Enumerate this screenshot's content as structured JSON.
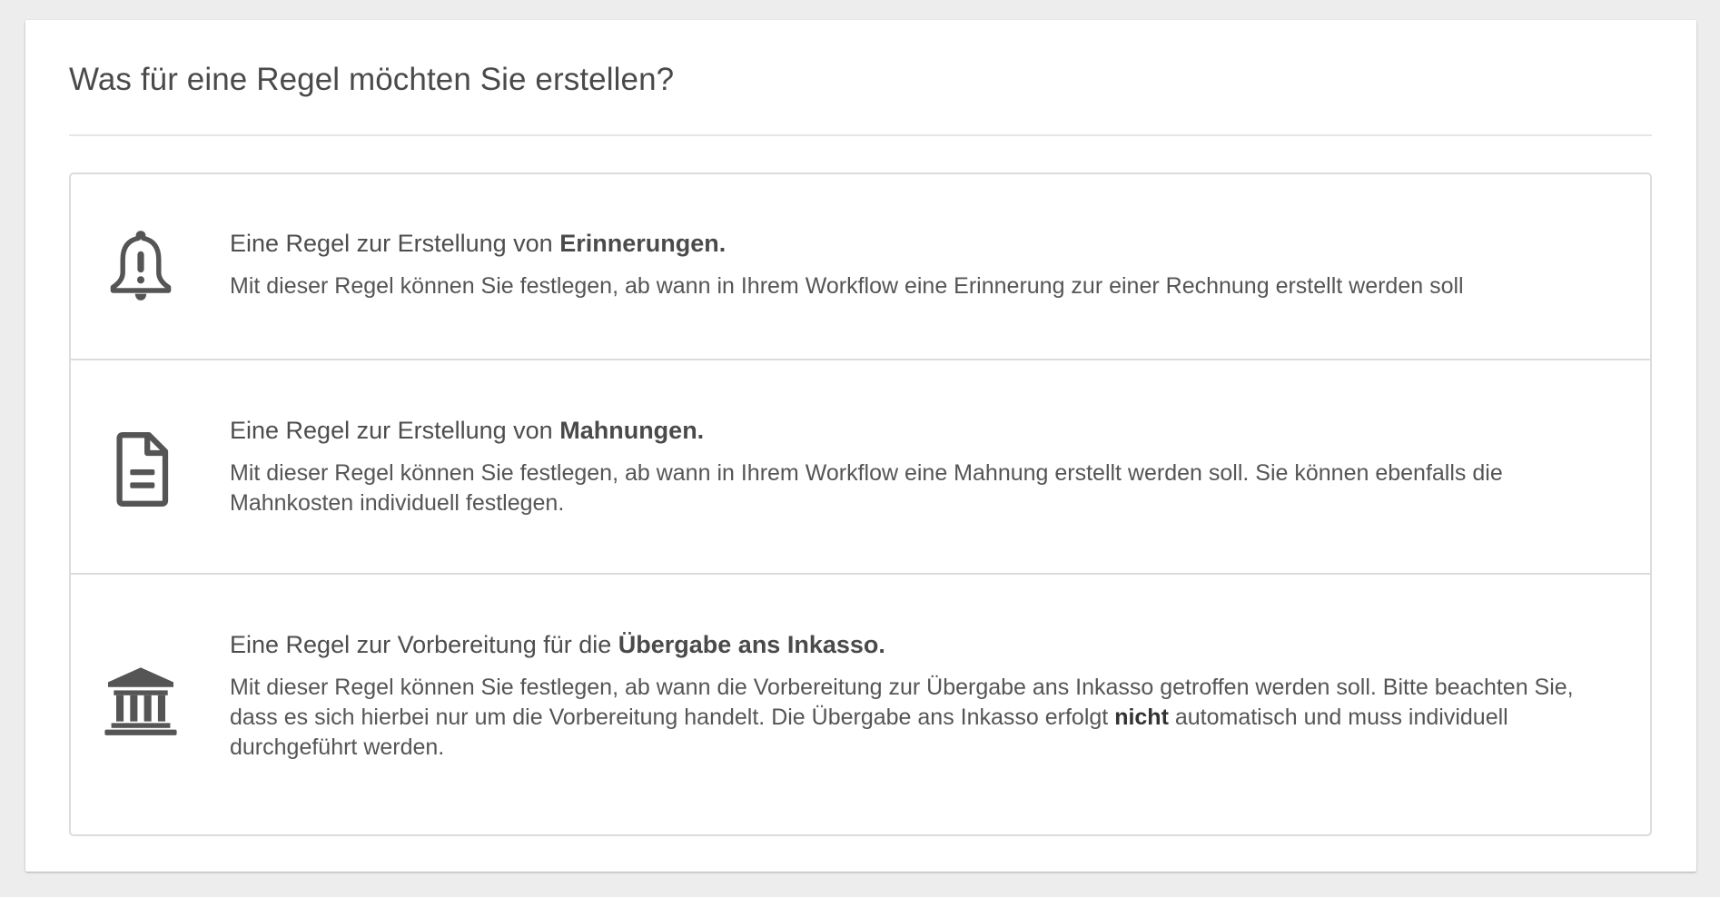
{
  "panel": {
    "title": "Was für eine Regel möchten Sie erstellen?"
  },
  "rules": [
    {
      "icon": "bell-exclamation-icon",
      "heading_prefix": "Eine Regel zur Erstellung von ",
      "heading_bold": "Erinnerungen.",
      "description": "Mit dieser Regel können Sie festlegen, ab wann in Ihrem Workflow eine Erinnerung zur einer Rechnung erstellt werden soll"
    },
    {
      "icon": "document-icon",
      "heading_prefix": "Eine Regel zur Erstellung von ",
      "heading_bold": "Mahnungen.",
      "description": "Mit dieser Regel können Sie festlegen, ab wann in Ihrem Workflow eine Mahnung erstellt werden soll. Sie können ebenfalls die Mahnkosten individuell festlegen."
    },
    {
      "icon": "bank-building-icon",
      "heading_prefix": "Eine Regel zur Vorbereitung für die ",
      "heading_bold": "Übergabe ans Inkasso.",
      "description_part1": "Mit dieser Regel können Sie festlegen, ab wann die Vorbereitung zur Übergabe ans Inkasso getroffen werden soll. Bitte beachten Sie, dass es sich hierbei nur um die Vorbereitung handelt. Die Übergabe ans Inkasso erfolgt ",
      "description_bold": "nicht",
      "description_part2": " automatisch und muss individuell durchgeführt werden."
    }
  ],
  "colors": {
    "background": "#ededed",
    "panel": "#ffffff",
    "text": "#515151",
    "icon": "#555555",
    "border": "#dcdcdc"
  }
}
